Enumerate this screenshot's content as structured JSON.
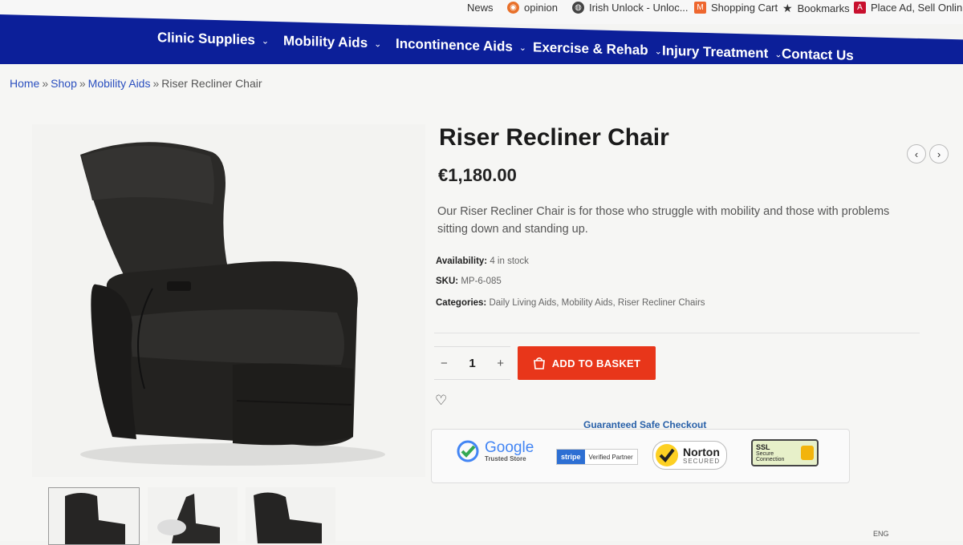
{
  "bookmarks": [
    {
      "label": "News",
      "icon": "news-icon"
    },
    {
      "label": "opinion",
      "icon": "opinion-icon"
    },
    {
      "label": "Irish Unlock - Unloc...",
      "icon": "globe-icon"
    },
    {
      "label": "Shopping Cart",
      "icon": "magento-icon"
    },
    {
      "label": "Bookmarks",
      "icon": "star-icon"
    },
    {
      "label": "Place Ad, Sell Onlin...",
      "icon": "adobe-icon"
    }
  ],
  "nav": [
    {
      "label": "Clinic Supplies",
      "dropdown": true
    },
    {
      "label": "Mobility Aids",
      "dropdown": true
    },
    {
      "label": "Incontinence Aids",
      "dropdown": true
    },
    {
      "label": "Exercise & Rehab",
      "dropdown": true
    },
    {
      "label": "Injury Treatment",
      "dropdown": true
    },
    {
      "label": "Contact Us",
      "dropdown": false
    }
  ],
  "breadcrumb": {
    "home": "Home",
    "shop": "Shop",
    "category": "Mobility Aids",
    "current": "Riser Recliner Chair",
    "separator": "»"
  },
  "product": {
    "title": "Riser Recliner Chair",
    "price": "€1,180.00",
    "description": "Our Riser Recliner Chair is for those who struggle with mobility and those with problems sitting down and standing up.",
    "availability_label": "Availability:",
    "availability_value": "4 in stock",
    "sku_label": "SKU:",
    "sku_value": "MP-6-085",
    "categories_label": "Categories:",
    "categories_value": "Daily Living Aids, Mobility Aids, Riser Recliner Chairs"
  },
  "cart": {
    "quantity": "1",
    "minus": "−",
    "plus": "+",
    "add_label": "ADD TO BASKET"
  },
  "safe_checkout": {
    "title": "Guaranteed Safe Checkout",
    "google_text": "Google",
    "google_sub": "Trusted Store",
    "stripe_text": "stripe",
    "stripe_sub": "Verified Partner",
    "norton_text": "Norton",
    "norton_sub": "SECURED",
    "ssl_text": "SSL",
    "ssl_sub1": "Secure",
    "ssl_sub2": "Connection"
  },
  "tray": {
    "lang": "ENG"
  },
  "colors": {
    "nav": "#0c1f99",
    "accent": "#e8361a",
    "link": "#2a4fbf"
  }
}
